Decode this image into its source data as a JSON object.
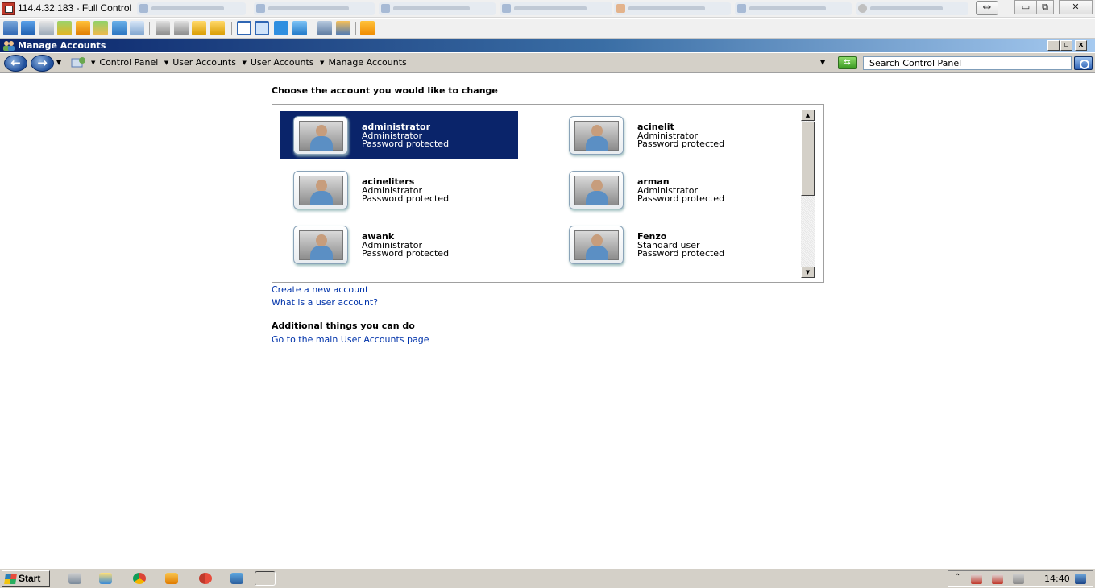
{
  "viewer": {
    "title": "114.4.32.183 - Full Control",
    "resize_symbol": "⇔",
    "controls": {
      "minimize": "▭",
      "restore": "⧉",
      "close": "✕"
    }
  },
  "window": {
    "title": "Manage Accounts",
    "controls": {
      "minimize": "_",
      "maximize": "▫",
      "close": "x"
    }
  },
  "address": {
    "breadcrumbs": [
      "Control Panel",
      "User Accounts",
      "User Accounts",
      "Manage Accounts"
    ],
    "search_placeholder": "Search Control Panel"
  },
  "main": {
    "heading": "Choose the account you would like to change",
    "accounts": [
      {
        "name": "administrator",
        "type": "Administrator",
        "status": "Password protected",
        "selected": true
      },
      {
        "name": "acinelit",
        "type": "Administrator",
        "status": "Password protected",
        "selected": false
      },
      {
        "name": "acineliters",
        "type": "Administrator",
        "status": "Password protected",
        "selected": false
      },
      {
        "name": "arman",
        "type": "Administrator",
        "status": "Password protected",
        "selected": false
      },
      {
        "name": "awank",
        "type": "Administrator",
        "status": "Password protected",
        "selected": false
      },
      {
        "name": "Fenzo",
        "type": "Standard user",
        "status": "Password protected",
        "selected": false
      }
    ],
    "links": {
      "create": "Create a new account",
      "what_is": "What is a user account?"
    },
    "additional_heading": "Additional things you can do",
    "additional_links": [
      "Go to the main User Accounts page"
    ]
  },
  "taskbar": {
    "start_label": "Start",
    "clock": "14:40"
  },
  "colors": {
    "selection": "#0a246a",
    "link": "#0033aa",
    "titlebar": "#0a246a"
  }
}
